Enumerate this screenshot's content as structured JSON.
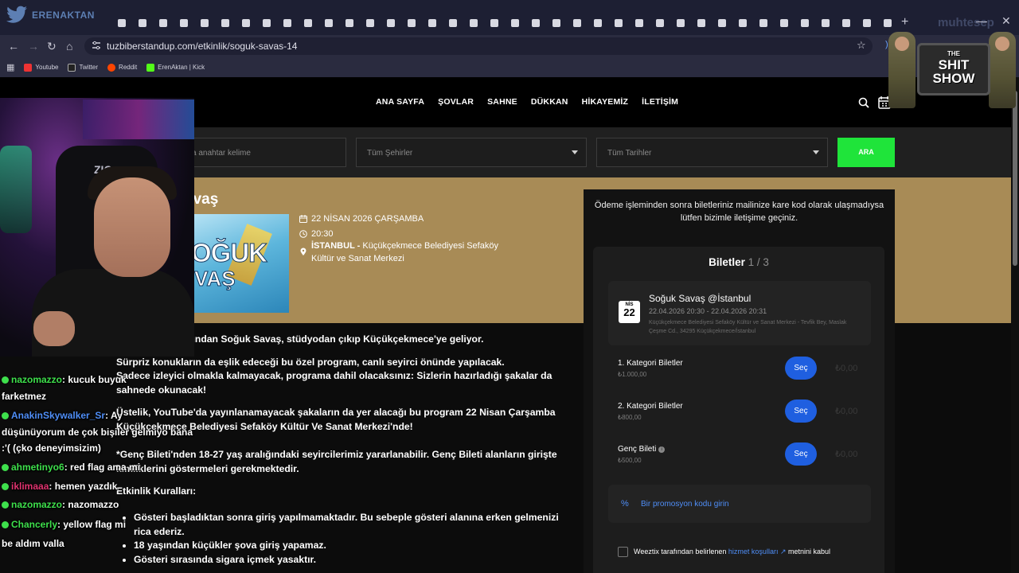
{
  "browser": {
    "url": "tuzbiberstandup.com/etkinlik/soguk-savas-14",
    "bookmarks": [
      "Youtube",
      "Twitter",
      "Reddit",
      "ErenAktan | Kick"
    ],
    "new_tab": "+"
  },
  "overlay": {
    "streamer_name": "ERENAKTAN",
    "show_title_small": "THE",
    "show_title": "SHIT SHOW",
    "watermark": "muhtesep"
  },
  "site": {
    "nav": [
      "ANA SAYFA",
      "ŞOVLAR",
      "SAHNE",
      "DÜKKAN",
      "HİKAYEMİZ",
      "İLETİŞİM"
    ],
    "search": {
      "keyword_placeholder": "ya anahtar kelime",
      "city": "Tüm Şehirler",
      "date": "Tüm Tarihler",
      "button": "ARA"
    },
    "event": {
      "title_visible": "avaş",
      "poster_line1": "OĞUK",
      "poster_line2": "VAŞ",
      "date": "22 NİSAN 2026 ÇARŞAMBA",
      "time": "20:30",
      "city": "İSTANBUL -",
      "venue": "Küçükçekmece Belediyesi Sefaköy",
      "venue2": "Kültür ve Sanat Merkezi"
    },
    "description": {
      "p1": "vilen programlarından Soğuk Savaş, stüdyodan çıkıp Küçükçekmece'ye geliyor.",
      "p2": "Sürpriz konukların da eşlik edeceği bu özel program, canlı seyirci önünde yapılacak.",
      "p3": "Sadece izleyici olmakla kalmayacak, programa dahil olacaksınız: Sizlerin hazırladığı şakalar da sahnede okunacak!",
      "p4": "Üstelik, YouTube'da yayınlanamayacak şakaların da yer alacağı bu program 22 Nisan Çarşamba Küçükçekmece Belediyesi Sefaköy Kültür Ve Sanat Merkezi'nde!",
      "p5": "*Genç Bileti'nden 18-27 yaş aralığındaki seyircilerimiz yararlanabilir. Genç Bileti alanların girişte kimliklerini göstermeleri gerekmektedir.",
      "rules_title": "Etkinlik Kuralları:",
      "rules": [
        "Gösteri başladıktan sonra giriş yapılmamaktadır. Bu sebeple gösteri alanına erken gelmenizi rica ederiz.",
        "18 yaşından küçükler şova giriş yapamaz.",
        "Gösteri sırasında sigara içmek yasaktır."
      ]
    },
    "sidebar": {
      "notice": "Ödeme işleminden sonra biletleriniz mailinize kare kod olarak ulaşmadıysa lütfen bizimle iletişime geçiniz.",
      "panel_title": "Biletler",
      "panel_step": "1 / 3",
      "event_month": "NİS",
      "event_day": "22",
      "event_name": "Soğuk Savaş @İstanbul",
      "event_time": "22.04.2026 20:30 - 22.04.2026 20:31",
      "event_address": "Küçükçekmece Belediyesi Sefaköy Kültür ve Sanat Merkezi - Tevfik Bey, Maslak Çeşme Cd., 34295 Küçükçekmece/İstanbul",
      "tickets": [
        {
          "name": "1. Kategori Biletler",
          "price": "₺1.000,00",
          "button": "Seç",
          "amount": "₺0,00"
        },
        {
          "name": "2. Kategori Biletler",
          "price": "₺800,00",
          "button": "Seç",
          "amount": "₺0,00"
        },
        {
          "name": "Genç Bileti",
          "price": "₺500,00",
          "button": "Seç",
          "amount": "₺0,00"
        }
      ],
      "promo": "Bir promosyon kodu girin",
      "terms_prefix": "Weeztix tarafından belirlenen",
      "terms_link": "hizmet koşulları",
      "terms_suffix": "metnini kabul"
    }
  },
  "chat": [
    {
      "user": "nazomazzo",
      "msg": ": kucuk buyuk",
      "color": "#3ee04c"
    },
    {
      "user": "",
      "msg": "farketmez",
      "color": "#ffffff"
    },
    {
      "user": "AnakinSkywalker_Sr",
      "msg": ": Ay",
      "color": "#4f8ef7"
    },
    {
      "user": "",
      "msg": "düşünüyorum de çok bişiler gelmiyo bana",
      "color": "#ffffff"
    },
    {
      "user": "",
      "msg": ":'( (çko deneyimsizim)",
      "color": "#ffffff"
    },
    {
      "user": "ahmetinyo6",
      "msg": ": red flag ama mi",
      "color": "#3ee04c"
    },
    {
      "user": "iklimaaa",
      "msg": ": hemen yazdık",
      "color": "#e0336f"
    },
    {
      "user": "nazomazzo",
      "msg": ": nazomazzo",
      "color": "#3ee04c"
    },
    {
      "user": "Chancerly",
      "msg": ": yellow flag mi",
      "color": "#3ee04c"
    },
    {
      "user": "",
      "msg": "be aldım valla",
      "color": "#ffffff"
    }
  ]
}
